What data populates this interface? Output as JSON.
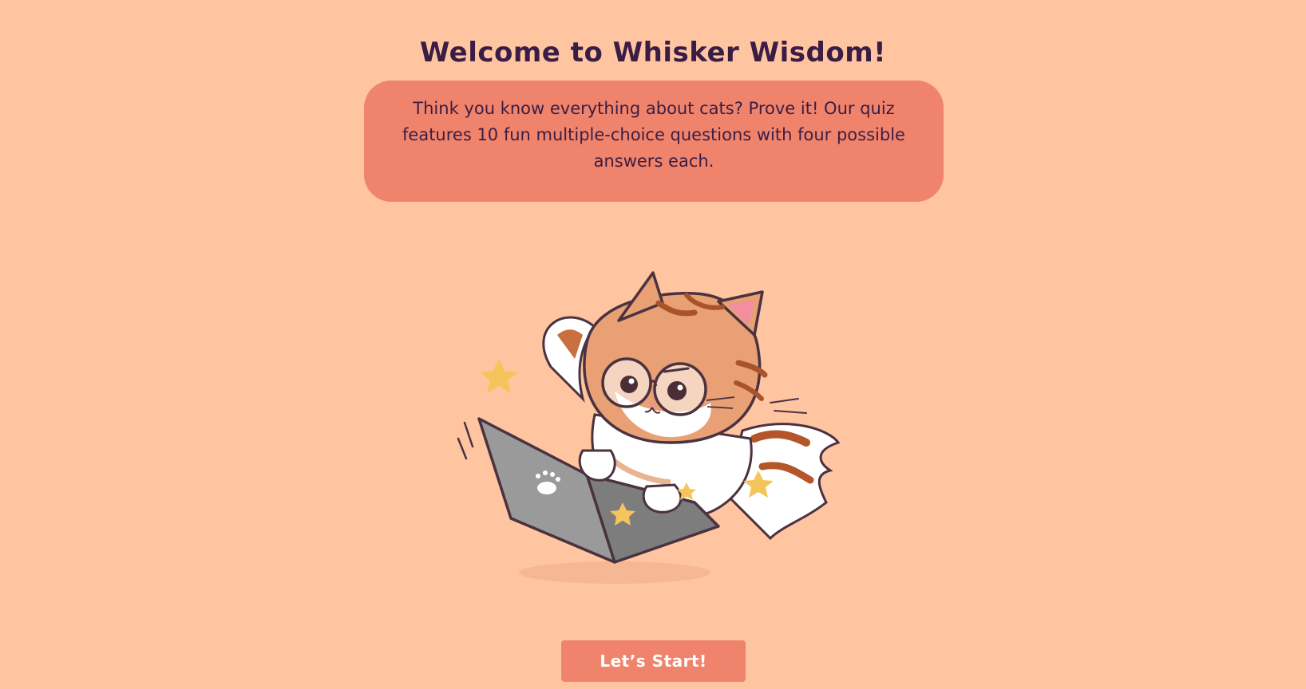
{
  "page": {
    "title": "Welcome to Whisker Wisdom!",
    "intro_text": "Think you know everything about cats? Prove it! Our quiz features 10 fun multiple-choice questions with four possible answers each.",
    "start_button_label": "Let’s Start!"
  },
  "colors": {
    "background": "#ffc4a0",
    "accent": "#f0836b",
    "text": "#3a1d45",
    "button_text": "#ffffff"
  },
  "illustration": {
    "subject": "cat-with-glasses-typing-on-laptop"
  }
}
